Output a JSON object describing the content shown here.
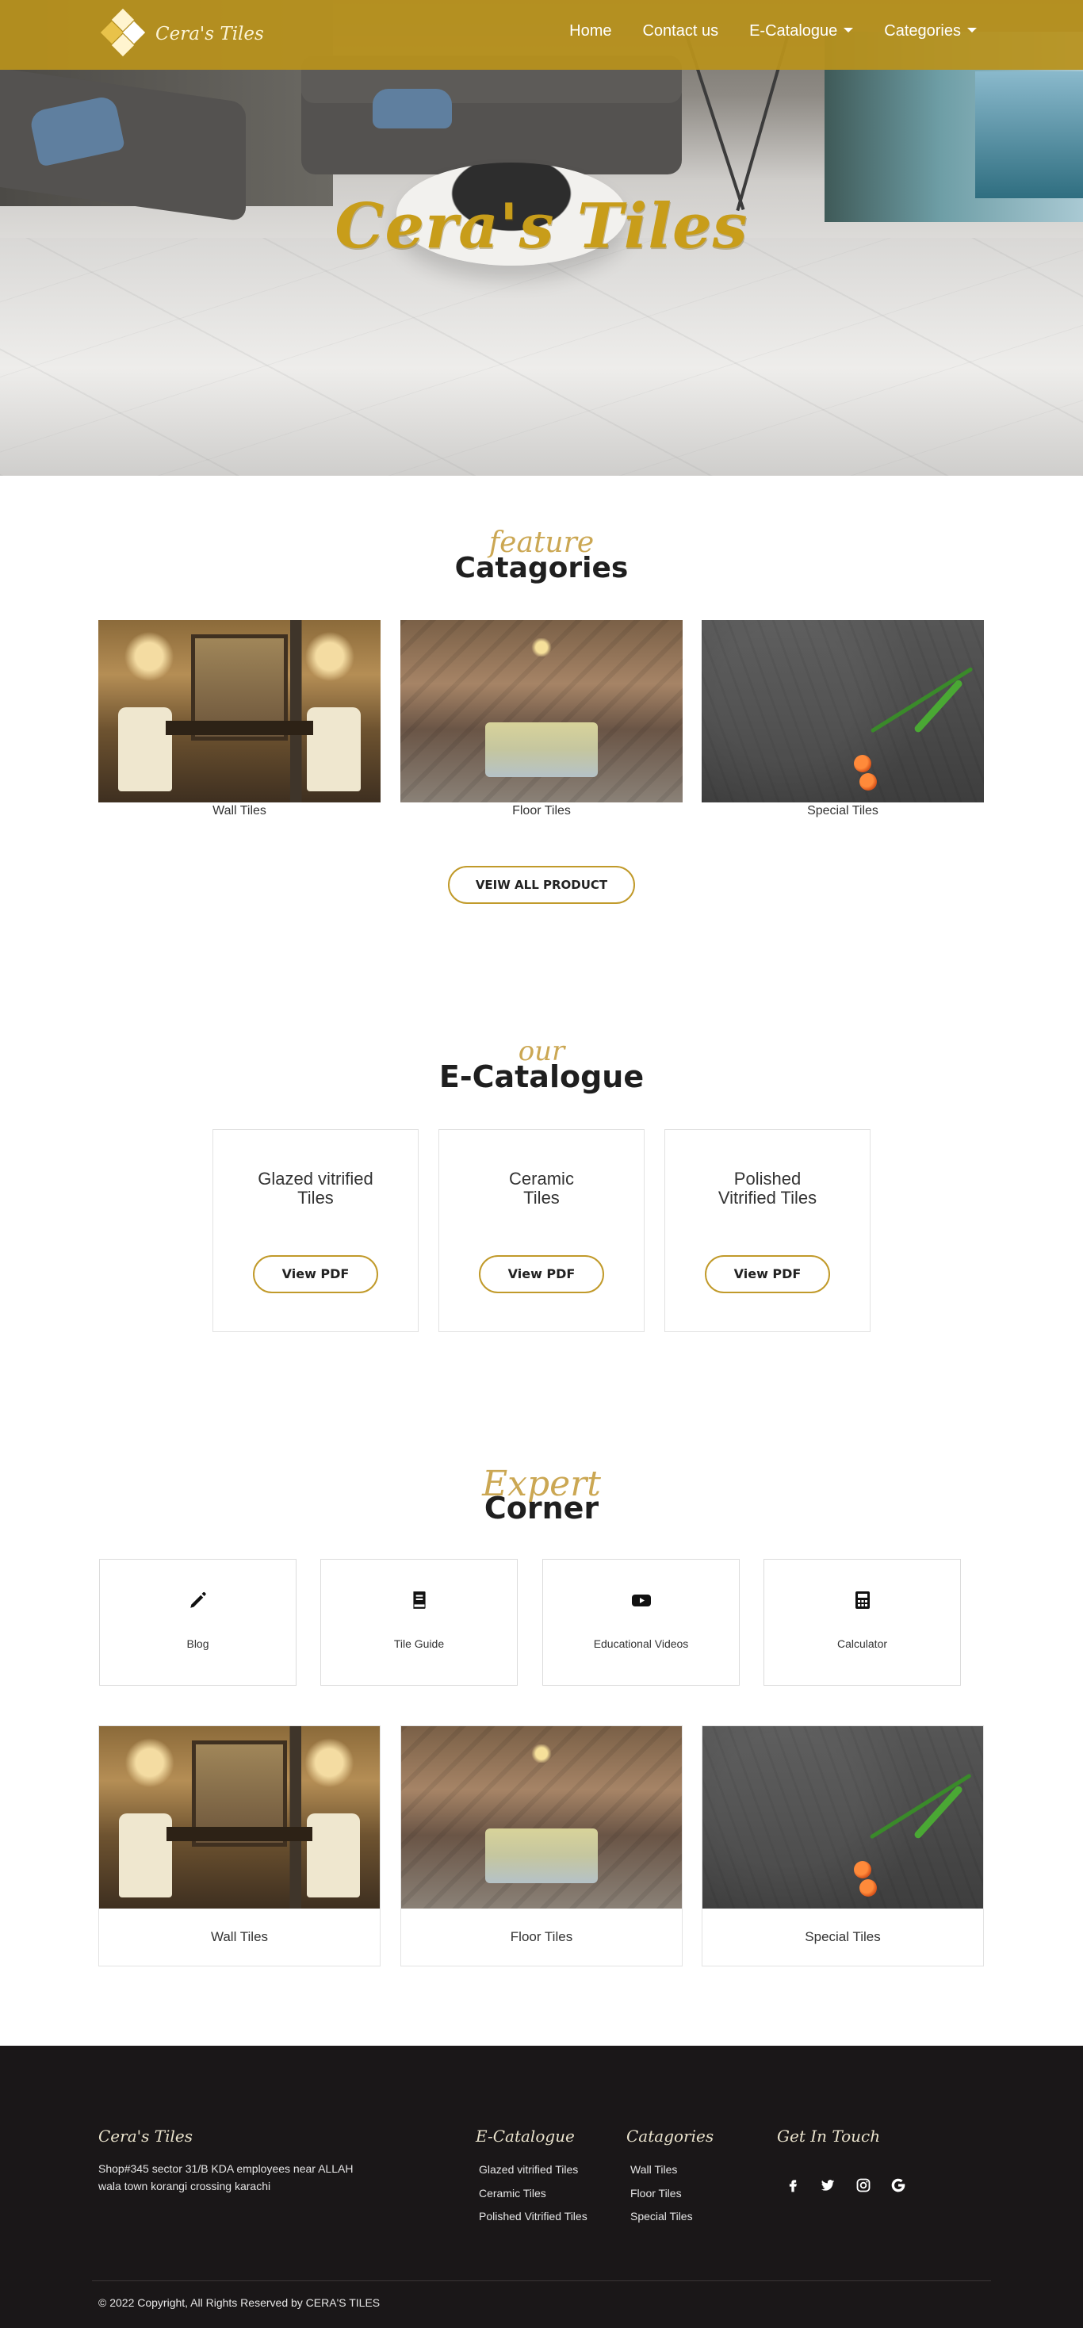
{
  "brand": {
    "name": "Cera's Tiles",
    "colors": {
      "gold": "#b9921c",
      "accent": "#c19a2a",
      "footer_bg": "#1a1718"
    }
  },
  "nav": {
    "items": [
      {
        "label": "Home",
        "dropdown": false
      },
      {
        "label": "Contact us",
        "dropdown": false
      },
      {
        "label": "E-Catalogue",
        "dropdown": true
      },
      {
        "label": "Categories",
        "dropdown": true
      }
    ]
  },
  "hero": {
    "title": "Cera's Tiles"
  },
  "featured": {
    "script_heading": "feature",
    "heading": "Catagories",
    "items": [
      {
        "label": "Wall Tiles",
        "image": "wall-tiles-photo"
      },
      {
        "label": "Floor Tiles",
        "image": "floor-tiles-photo"
      },
      {
        "label": "Special Tiles",
        "image": "special-tiles-photo"
      }
    ],
    "button_label": "VEIW ALL PRODUCT"
  },
  "catalogue": {
    "script_heading": "our",
    "heading": "E-Catalogue",
    "cards": [
      {
        "title_line1": "Glazed vitrified",
        "title_line2": "Tiles",
        "button_label": "View PDF"
      },
      {
        "title_line1": "Ceramic",
        "title_line2": "Tiles",
        "button_label": "View PDF"
      },
      {
        "title_line1": "Polished",
        "title_line2": "Vitrified Tiles",
        "button_label": "View PDF"
      }
    ]
  },
  "expert": {
    "script_heading": "Expert",
    "heading": "Corner",
    "cards": [
      {
        "label": "Blog",
        "icon": "pencil-icon"
      },
      {
        "label": "Tile Guide",
        "icon": "book-icon"
      },
      {
        "label": "Educational Videos",
        "icon": "youtube-icon"
      },
      {
        "label": "Calculator",
        "icon": "calculator-icon"
      }
    ],
    "products": [
      {
        "label": "Wall Tiles"
      },
      {
        "label": "Floor Tiles"
      },
      {
        "label": "Special Tiles"
      }
    ]
  },
  "footer": {
    "brand_heading": "Cera's Tiles",
    "address_line1": "Shop#345 sector 31/B KDA employees near ALLAH",
    "address_line2": "wala town korangi crossing karachi",
    "catalogue_heading": "E-Catalogue",
    "catalogue_links": [
      "Glazed vitrified Tiles",
      "Ceramic Tiles",
      "Polished Vitrified Tiles"
    ],
    "categories_heading": "Catagories",
    "categories_links": [
      "Wall Tiles",
      "Floor Tiles",
      "Special Tiles"
    ],
    "contact_heading": "Get In Touch",
    "social": [
      {
        "name": "facebook-icon",
        "glyph": "f"
      },
      {
        "name": "twitter-icon",
        "glyph": "t"
      },
      {
        "name": "instagram-icon",
        "glyph": "ig"
      },
      {
        "name": "google-icon",
        "glyph": "G"
      }
    ],
    "copyright": "© 2022 Copyright, All Rights Reserved by CERA'S TILES"
  }
}
